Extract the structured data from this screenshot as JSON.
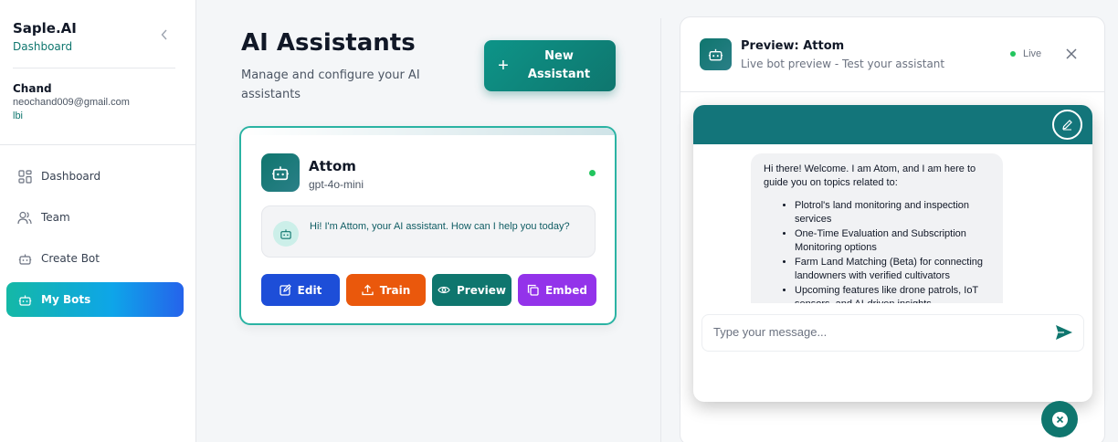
{
  "sidebar": {
    "brand_name": "Saple.AI",
    "brand_sub": "Dashboard",
    "collapse_icon": "chevron-left-icon",
    "user": {
      "name": "Chand",
      "email": "neochand009@gmail.com",
      "org": "lbi"
    },
    "items": [
      {
        "label": "Dashboard",
        "icon": "grid-icon",
        "active": false
      },
      {
        "label": "Team",
        "icon": "users-icon",
        "active": false
      },
      {
        "label": "Create Bot",
        "icon": "bot-icon",
        "active": false
      },
      {
        "label": "My Bots",
        "icon": "bot-icon",
        "active": true
      }
    ]
  },
  "main": {
    "title": "AI Assistants",
    "subtitle": "Manage and configure your AI assistants",
    "new_button": {
      "plus": "+",
      "label": "New Assistant"
    }
  },
  "bot_card": {
    "name": "Attom",
    "model": "gpt-4o-mini",
    "status_color": "#22c55e",
    "greeting": "Hi! I'm Attom, your AI assistant. How can I help you today?",
    "actions": {
      "edit": "Edit",
      "train": "Train",
      "preview": "Preview",
      "embed": "Embed"
    }
  },
  "preview": {
    "title": "Preview: Attom",
    "subtitle": "Live bot preview - Test your assistant",
    "live_label": "Live",
    "message_intro": "Hi there! Welcome. I am Atom, and I am here to guide you on topics related to:",
    "message_items": [
      "Plotrol's land monitoring and inspection services",
      "One-Time Evaluation and Subscription Monitoring options",
      "Farm Land Matching (Beta) for connecting landowners with verified cultivators",
      "Upcoming features like drone patrols, IoT sensors, and AI-driven insights"
    ],
    "input_placeholder": "Type your message..."
  },
  "colors": {
    "brand_teal": "#0f766e",
    "widget_header": "#13757a",
    "edit": "#1d4ed8",
    "train": "#ea580c",
    "preview": "#0f766e",
    "embed": "#9333ea",
    "live": "#22c55e"
  }
}
